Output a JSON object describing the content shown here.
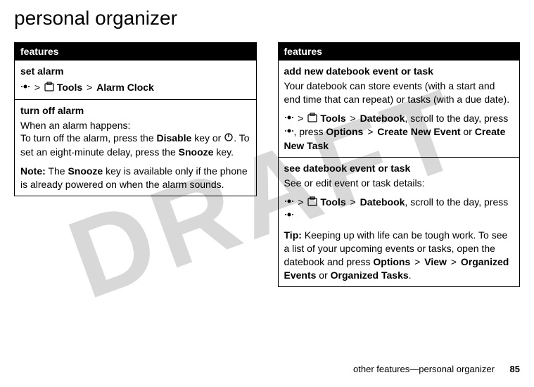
{
  "watermark": "DRAFT",
  "page_title": "personal organizer",
  "left_table": {
    "header": "features",
    "rows": [
      {
        "title": "set alarm",
        "path_parts": {
          "tools": "Tools",
          "alarm_clock": "Alarm Clock"
        }
      },
      {
        "title": "turn off alarm",
        "body1": "When an alarm happens:",
        "body2_pre": "To turn off the alarm, press the ",
        "disable": "Disable",
        "body2_mid": " key or ",
        "body2_post": ". To set an eight-minute delay, press the ",
        "snooze": "Snooze",
        "body2_end": " key.",
        "note_label": "Note:",
        "note_pre": " The ",
        "note_snooze": "Snooze",
        "note_post": " key is available only if the phone is already powered on when the alarm sounds."
      }
    ]
  },
  "right_table": {
    "header": "features",
    "rows": [
      {
        "title": "add new datebook event or task",
        "body": "Your datebook can store events (with a start and end time that can repeat) or tasks (with a due date).",
        "path": {
          "tools": "Tools",
          "datebook": "Datebook",
          "scroll": ", scroll to the day, press ",
          "press_options": ", press ",
          "options": "Options",
          "create_new_event": "Create New Event",
          "or": " or ",
          "create_new_task": "Create New Task"
        }
      },
      {
        "title": "see datebook event or task",
        "body": "See or edit event or task details:",
        "path": {
          "tools": "Tools",
          "datebook": "Datebook",
          "scroll": ", scroll to the day, press "
        },
        "tip_label": "Tip:",
        "tip_body": " Keeping up with life can be tough work. To see a list of your upcoming events or tasks, open the datebook and press ",
        "options": "Options",
        "view": "View",
        "organized_events": "Organized Events",
        "or": " or ",
        "organized_tasks": "Organized Tasks",
        "period": "."
      }
    ]
  },
  "footer": {
    "text": "other features—personal organizer",
    "page_number": "85"
  }
}
